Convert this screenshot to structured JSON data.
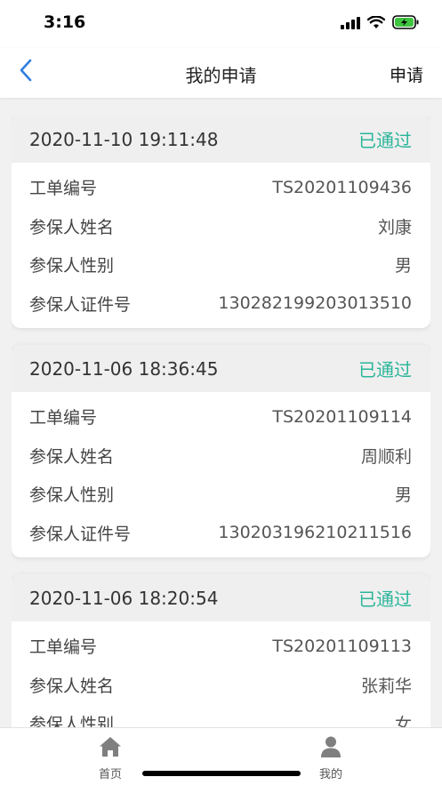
{
  "status_bar": {
    "time": "3:16"
  },
  "nav": {
    "title": "我的申请",
    "action_label": "申请",
    "back_icon": "chevron-left-icon",
    "accent": "#2f7ee0"
  },
  "status_color": "#2bb59a",
  "cards": [
    {
      "time": "2020-11-10 19:11:48",
      "status": "已通过",
      "rows": [
        {
          "label": "工单编号",
          "value": "TS20201109436"
        },
        {
          "label": "参保人姓名",
          "value": "刘康"
        },
        {
          "label": "参保人性别",
          "value": "男"
        },
        {
          "label": "参保人证件号",
          "value": "130282199203013510"
        }
      ]
    },
    {
      "time": "2020-11-06 18:36:45",
      "status": "已通过",
      "rows": [
        {
          "label": "工单编号",
          "value": "TS20201109114"
        },
        {
          "label": "参保人姓名",
          "value": "周顺利"
        },
        {
          "label": "参保人性别",
          "value": "男"
        },
        {
          "label": "参保人证件号",
          "value": "130203196210211516"
        }
      ]
    },
    {
      "time": "2020-11-06 18:20:54",
      "status": "已通过",
      "rows": [
        {
          "label": "工单编号",
          "value": "TS20201109113"
        },
        {
          "label": "参保人姓名",
          "value": "张莉华"
        },
        {
          "label": "参保人性别",
          "value": "女"
        }
      ]
    }
  ],
  "tabs": [
    {
      "label": "首页",
      "icon": "home-icon"
    },
    {
      "label": "我的",
      "icon": "user-icon"
    }
  ]
}
